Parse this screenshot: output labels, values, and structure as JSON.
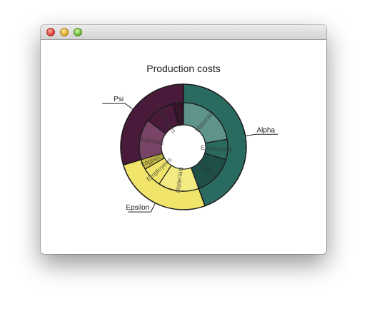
{
  "window": {
    "title": "",
    "buttons": [
      "close",
      "minimize",
      "zoom"
    ]
  },
  "chart_data": {
    "type": "pie",
    "title": "Production costs",
    "legend": "none",
    "series": [
      {
        "name": "Alpha",
        "color": "#2a6b61",
        "inner_color": "#5f948c",
        "dark_color": "#1e5048",
        "values": [
          {
            "label": "Materials",
            "value": 6
          },
          {
            "label": "Employees",
            "value": 2
          },
          {
            "label": "Logistics",
            "value": 4
          }
        ]
      },
      {
        "name": "Epsilon",
        "color": "#f0e56a",
        "inner_color": "#f4ec82",
        "dark_color": "#c8bb45",
        "values": [
          {
            "label": "Materials",
            "value": 4
          },
          {
            "label": "Employees",
            "value": 2
          },
          {
            "label": "Logistics",
            "value": 1
          }
        ]
      },
      {
        "name": "Psi",
        "color": "#4a1a3a",
        "inner_color": "#7a4466",
        "dark_color": "#351028",
        "values": [
          {
            "label": "Materials",
            "value": 4
          },
          {
            "label": "Employees",
            "value": 3
          },
          {
            "label": "Logistics",
            "value": 1
          }
        ]
      }
    ]
  }
}
